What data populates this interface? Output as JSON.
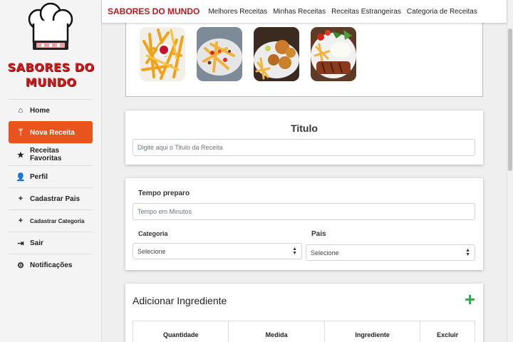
{
  "brand": {
    "logo_text": "SABORES DO MUNDO",
    "title": "SABORES DO MUNDO",
    "color": "#c0171d"
  },
  "topnav": [
    "Melhores Receitas",
    "Minhas Receitas",
    "Receitas Estrangeiras",
    "Categoria de Receitas"
  ],
  "sidebar": {
    "items": [
      {
        "label": "Home",
        "icon": "home-icon",
        "glyph": "⌂"
      },
      {
        "label": "Nova Receita",
        "icon": "utensils-icon",
        "glyph": "ᛘ",
        "active": true
      },
      {
        "label": "Receitas Favoritas",
        "icon": "star-icon",
        "glyph": "★"
      },
      {
        "label": "Perfil",
        "icon": "user-icon",
        "glyph": "👤"
      },
      {
        "label": "Cadastrar Pais",
        "icon": "plus-icon",
        "glyph": "+"
      },
      {
        "label": "Cadastrar Categoria",
        "icon": "plus-icon",
        "glyph": "+"
      },
      {
        "label": "Sair",
        "icon": "sign-out-icon",
        "glyph": "⇥"
      },
      {
        "label": "Notificações",
        "icon": "cogs-icon",
        "glyph": "⚙"
      }
    ],
    "accent": "#e8531e"
  },
  "gallery": [
    "fries-with-ketchup",
    "loaded-fries",
    "fried-chicken-and-fries",
    "steak-rice-and-fries"
  ],
  "title_section": {
    "heading": "Titulo",
    "placeholder": "Digite aqui o Titulo da Receita"
  },
  "prep_section": {
    "time_label": "Tempo preparo",
    "time_placeholder": "Tempo em Minutos",
    "category_label": "Categoria",
    "category_value": "Selecione",
    "country_label": "Pais",
    "country_value": "Selecione"
  },
  "ingredients": {
    "heading": "Adicionar Ingrediente",
    "add_icon": "plus-icon",
    "add_color": "#1fb24a",
    "columns": [
      "Quantidade",
      "Medida",
      "Ingrediente",
      "Excluir"
    ]
  }
}
